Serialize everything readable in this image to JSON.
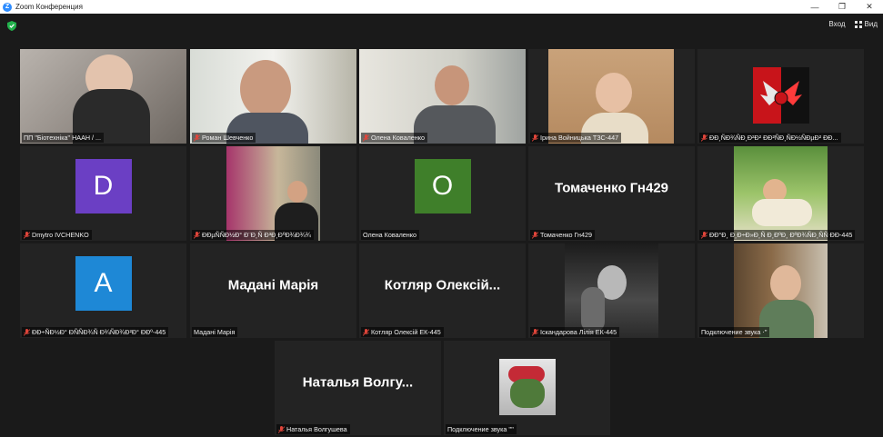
{
  "window": {
    "title": "Zoom Конференция",
    "app_icon_glyph": "Z",
    "min_glyph": "—",
    "max_glyph": "❐",
    "close_glyph": "✕"
  },
  "toolbar": {
    "enter_label": "Вход",
    "view_label": "Вид"
  },
  "colors": {
    "active_speaker": "#c6e34a",
    "avatar_d": "#6b3fc4",
    "avatar_o": "#3f7f2a",
    "avatar_a": "#1e88d6",
    "muted_mic": "#e0453a"
  },
  "participants": [
    {
      "name": "ПП \"Біотехніка\" НААН / ...",
      "muted": false
    },
    {
      "name": "Роман Шевченко",
      "muted": true
    },
    {
      "name": "Олена Коваленко",
      "muted": true
    },
    {
      "name": "Ірина Войницька ТЗС-447",
      "muted": true
    },
    {
      "name": "ÐÐ¸ÑÐ¾ÑÐ¸Ð²Ð² ÐÐ²ÑÐ¸ÑÐ½ÑÐµÐ² ÐÐ...",
      "muted": true
    },
    {
      "name": "Dmytro IVCHENKO",
      "muted": true,
      "avatar": "D"
    },
    {
      "name": "ÐÐµÑÑÐ½Ð° Ð¨Ð¸Ñ Ð³Ð¸ÐºÐ¾Ð¾¾",
      "muted": true
    },
    {
      "name": "Олена Коваленко",
      "muted": false,
      "avatar": "O"
    },
    {
      "name": "Томаченко Гн429",
      "muted": true,
      "display": "Томаченко Гн429"
    },
    {
      "name": "ÐÐ°Ð¸ Ð¸Ð÷Ð»Ð¸Ñ Ð¸ÐºÐ¸ ÐºÐ¾ÑÐ¸ÑÑ ÐÐ-445",
      "muted": true
    },
    {
      "name": "ÐÐ÷ÑÐ½Ð° ÐÑÑÐ¾Ñ Ð¾ÑÐ¾Ð²Ð° ÐÐº-445",
      "muted": true,
      "avatar": "A"
    },
    {
      "name": "Мадані Марія",
      "muted": false,
      "display": "Мадані Марія"
    },
    {
      "name": "Котляр Олексій ЕК-445",
      "muted": true,
      "display": "Котляр Олексій..."
    },
    {
      "name": "Іскандарова Лілія ЕК-445",
      "muted": true
    },
    {
      "name": "Подключение звука ‧''",
      "muted": false
    },
    {
      "name": "Наталья Волгушева",
      "muted": true,
      "display": "Наталья Волгу..."
    },
    {
      "name": "Подключение звука ''''",
      "muted": false
    }
  ]
}
